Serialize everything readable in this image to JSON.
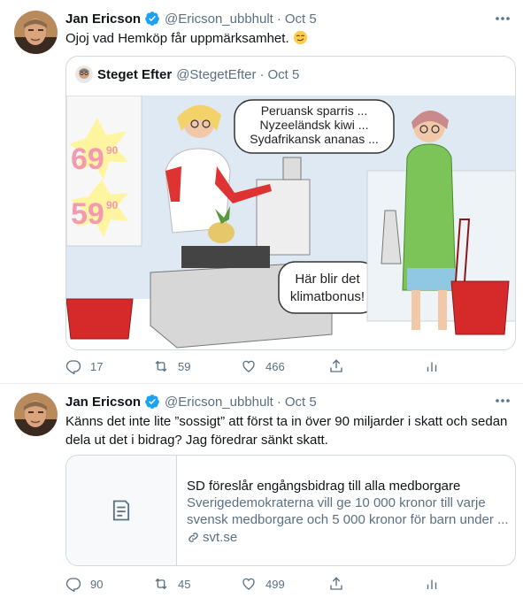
{
  "tweets": [
    {
      "author_name": "Jan Ericson",
      "handle": "@Ericson_ubbhult",
      "separator": "·",
      "time": "Oct 5",
      "text": "Ojoj vad Hemköp får uppmärksamhet.",
      "emoji_icon": "smirk-emoji-icon",
      "quote": {
        "author_name": "Steget Efter",
        "handle": "@StegetEfter",
        "separator": "·",
        "time": "Oct 5",
        "cartoon": {
          "price_1": "69",
          "price_1_cents": "90",
          "price_2": "59",
          "price_2_cents": "90",
          "speech_1": [
            "Peruansk sparris ...",
            "Nyzeeländsk kiwi ...",
            "Sydafrikansk ananas ..."
          ],
          "speech_2": [
            "Här blir det",
            "klimatbonus!"
          ]
        }
      },
      "replies": "17",
      "retweets": "59",
      "likes": "466"
    },
    {
      "author_name": "Jan Ericson",
      "handle": "@Ericson_ubbhult",
      "separator": "·",
      "time": "Oct 5",
      "text": "Känns det inte lite ”sossigt” att först ta in över 90 miljarder i skatt och sedan dela ut det i bidrag? Jag föredrar sänkt skatt.",
      "card": {
        "title": "SD föreslår engångsbidrag till alla medborgare",
        "description": "Sverigedemokraterna vill ge 10 000 kronor till varje svensk medborgare och 5 000 kronor för barn under ...",
        "domain": "svt.se"
      },
      "replies": "90",
      "retweets": "45",
      "likes": "499"
    }
  ],
  "colors": {
    "verified": "#1da1f2",
    "secondary_text": "#5b7083",
    "border": "#cfd9de"
  }
}
